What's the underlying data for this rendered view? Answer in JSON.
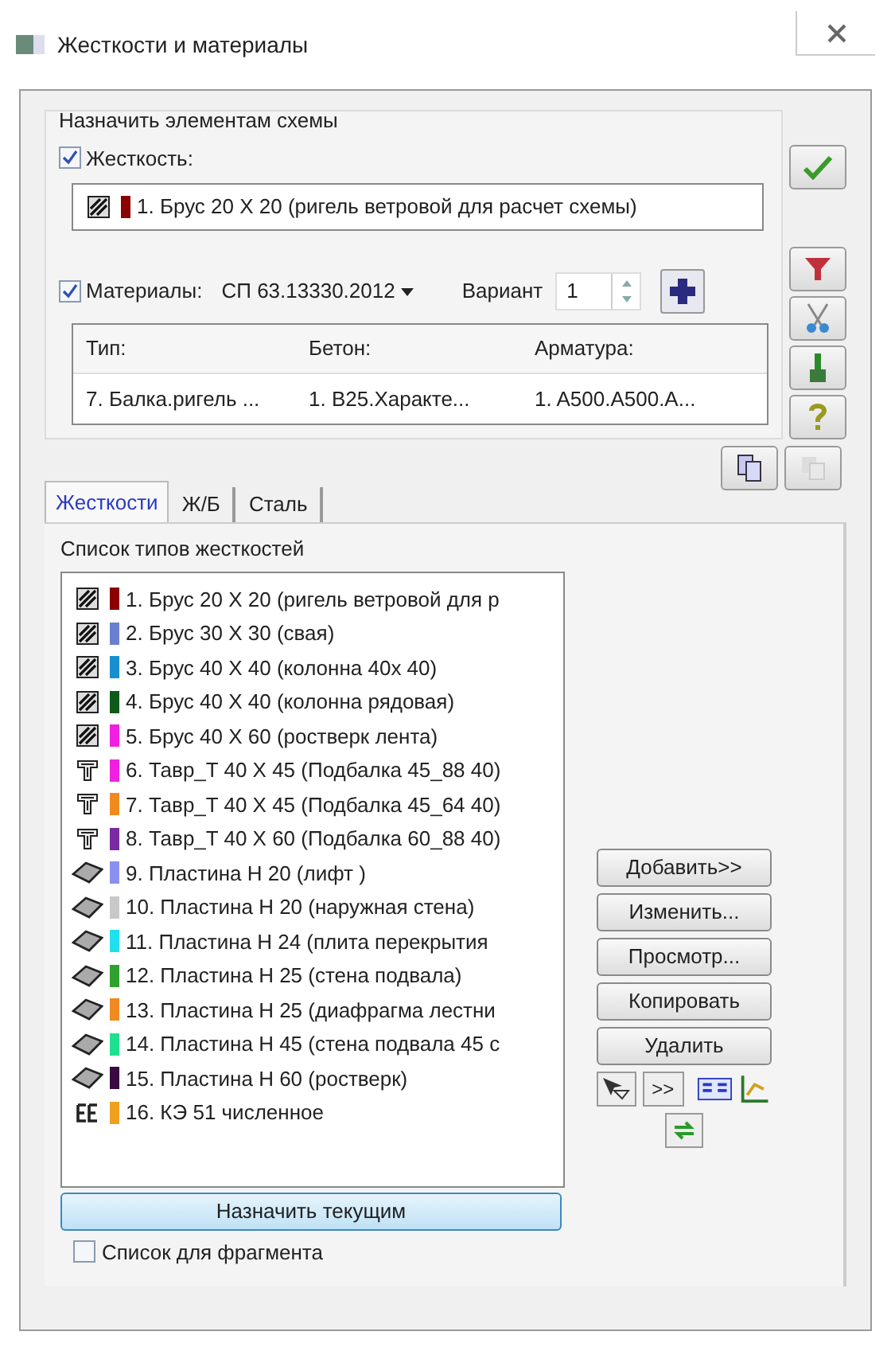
{
  "window": {
    "title": "Жесткости и материалы"
  },
  "assign_group": {
    "title": "Назначить элементам схемы",
    "stiffness": {
      "label": "Жесткость:",
      "checked": true
    },
    "current_stiffness": {
      "kind": "rect",
      "color": "#8b0000",
      "text": "1. Брус 20 X 20 (ригель ветровой для расчет схемы)"
    },
    "materials": {
      "label": "Материалы:",
      "checked": true,
      "norm": "СП 63.13330.2012"
    },
    "variant": {
      "label": "Вариант",
      "value": "1"
    },
    "table": {
      "columns": [
        "Тип:",
        "Бетон:",
        "Арматура:"
      ],
      "rows": [
        [
          "7. Балка.ригель ...",
          "1. B25.Характе...",
          "1. A500.A500.A..."
        ]
      ]
    }
  },
  "tabs": [
    {
      "label": "Жесткости",
      "selected": true
    },
    {
      "label": "Ж/Б",
      "selected": false
    },
    {
      "label": "Сталь",
      "selected": false
    }
  ],
  "list": {
    "title": "Список типов жесткостей",
    "items": [
      {
        "kind": "rect",
        "color": "#8b0000",
        "text": "1. Брус 20 X 20 (ригель ветровой для р"
      },
      {
        "kind": "rect",
        "color": "#6a7fd0",
        "text": "2. Брус 30 X 30 (свая)"
      },
      {
        "kind": "rect",
        "color": "#1a8fd0",
        "text": "3. Брус 40 X 40 (колонна 40x 40)"
      },
      {
        "kind": "rect",
        "color": "#0b5a1a",
        "text": "4. Брус 40 X 40 (колонна  рядовая)"
      },
      {
        "kind": "rect",
        "color": "#f020e0",
        "text": "5. Брус 40 X 60 (ростверк лента)"
      },
      {
        "kind": "tee",
        "color": "#f020e0",
        "text": "6. Тавр_T 40 X 45 (Подбалка 45_88 40)"
      },
      {
        "kind": "tee",
        "color": "#f08a20",
        "text": "7. Тавр_T 40 X 45 (Подбалка 45_64 40)"
      },
      {
        "kind": "tee",
        "color": "#7a2aa0",
        "text": "8. Тавр_T 40 X 60 (Подбалка 60_88 40)"
      },
      {
        "kind": "plate",
        "color": "#8a90f0",
        "text": "9. Пластина  H 20 (лифт )"
      },
      {
        "kind": "plate",
        "color": "#c8c8c8",
        "text": "10. Пластина  H 20 (наружная стена)"
      },
      {
        "kind": "plate",
        "color": "#20e0f0",
        "text": "11. Пластина  H 24 (плита перекрытия"
      },
      {
        "kind": "plate",
        "color": "#30a030",
        "text": "12. Пластина  H 25 (стена подвала)"
      },
      {
        "kind": "plate",
        "color": "#f08a20",
        "text": "13. Пластина  H 25 (диафрагма  лестни"
      },
      {
        "kind": "plate",
        "color": "#20e090",
        "text": "14. Пластина  H 45 (стена подвала 45 с"
      },
      {
        "kind": "plate",
        "color": "#3a0a40",
        "text": "15. Пластина  H 60 (ростверк)"
      },
      {
        "kind": "fe",
        "color": "#f0a020",
        "text": "16. КЭ 51 численное"
      }
    ]
  },
  "buttons": [
    "Добавить>>",
    "Изменить...",
    "Просмотр...",
    "Копировать",
    "Удалить"
  ],
  "more_button": ">>",
  "assign_button": "Назначить текущим",
  "fragment": {
    "label": "Список для фрагмента",
    "checked": false
  }
}
